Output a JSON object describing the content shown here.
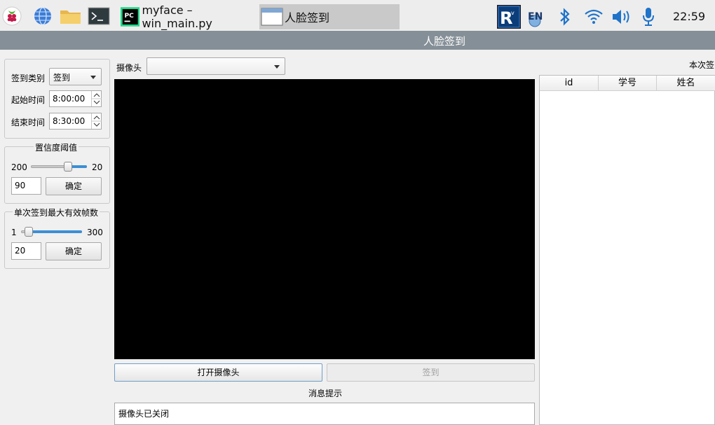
{
  "taskbar": {
    "tasks": [
      {
        "label": "myface – win_main.py"
      },
      {
        "label": "人脸签到"
      }
    ],
    "clock": "22:59",
    "ime_badge": "EN"
  },
  "window": {
    "title": "人脸签到"
  },
  "left": {
    "signin_type_label": "签到类别",
    "signin_type_value": "签到",
    "start_time_label": "起始时间",
    "start_time_value": "8:00:00",
    "end_time_label": "结束时间",
    "end_time_value": "8:30:00",
    "confidence": {
      "title": "置信度阈值",
      "min_label": "200",
      "max_label": "20",
      "level": 0.69,
      "input_value": "90",
      "confirm_label": "确定"
    },
    "max_frames": {
      "title": "单次签到最大有效帧数",
      "min_label": "1",
      "max_label": "300",
      "level": 0.06,
      "input_value": "20",
      "confirm_label": "确定"
    }
  },
  "center": {
    "camera_label": "摄像头",
    "camera_value": "",
    "open_camera_label": "打开摄像头",
    "signin_label": "签到",
    "message_title": "消息提示",
    "message_text": "摄像头已关闭"
  },
  "right": {
    "title_partial": "本次签",
    "columns": [
      "id",
      "学号",
      "姓名"
    ]
  },
  "colors": {
    "accent": "#3c8fd4",
    "titlebar": "#858f97",
    "taskbar": "#ededed"
  }
}
